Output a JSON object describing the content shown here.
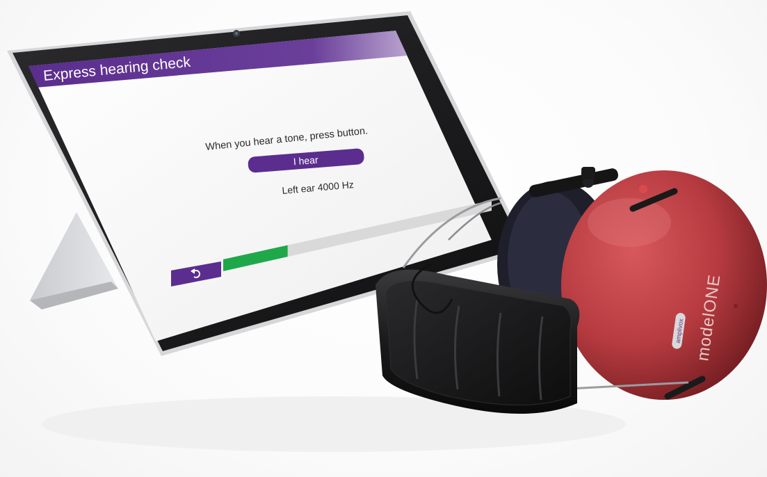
{
  "app": {
    "title": "Express hearing check"
  },
  "instruction": "When you hear a tone, press button.",
  "hear_button_label": "I hear",
  "status": "Left ear 4000 Hz",
  "progress": {
    "fraction": 0.24
  },
  "back_button": {
    "icon": "undo-arrow-icon"
  },
  "headphones": {
    "model_label": "modelONE",
    "brand_label": "amplivox"
  },
  "colors": {
    "brand_purple": "#5b2d8e",
    "progress_green": "#1fa84a",
    "cup_red": "#b63b40"
  }
}
